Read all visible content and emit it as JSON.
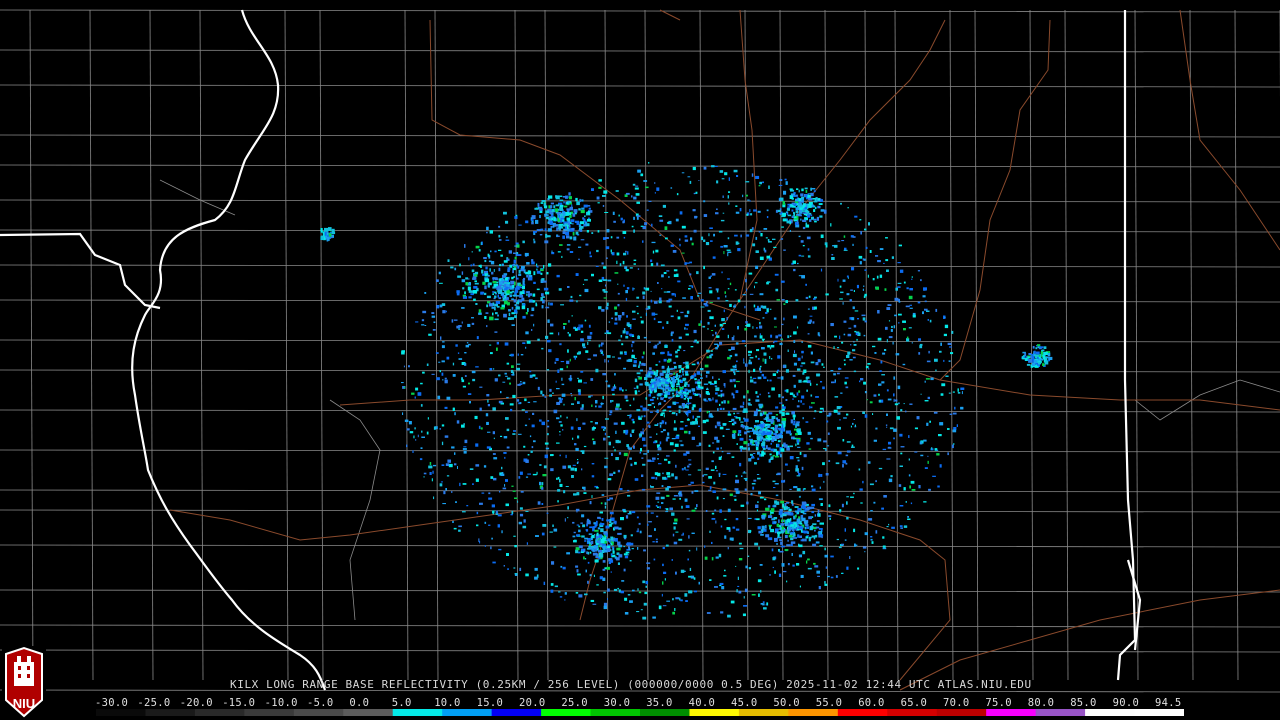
{
  "product": {
    "caption": "KILX LONG RANGE BASE REFLECTIVITY (0.25KM / 256 LEVEL) (000000/0000 0.5 DEG) 2025-11-02 12:44 UTC  ATLAS.NIU.EDU"
  },
  "scale": {
    "labels": [
      "-30.0",
      "-25.0",
      "-20.0",
      "-15.0",
      "-10.0",
      "-5.0",
      "0.0",
      "5.0",
      "10.0",
      "15.0",
      "20.0",
      "25.0",
      "30.0",
      "35.0",
      "40.0",
      "45.0",
      "50.0",
      "55.0",
      "60.0",
      "65.0",
      "70.0",
      "75.0",
      "80.0",
      "85.0",
      "90.0",
      "94.5"
    ],
    "colors": [
      "#0a0a0a",
      "#1a1a1a",
      "#2a2a2a",
      "#3a3a3a",
      "#4a4a4a",
      "#5c5c5c",
      "#04e9e7",
      "#019ff4",
      "#0300f4",
      "#02fd02",
      "#01c501",
      "#008e00",
      "#fdf802",
      "#e5bc00",
      "#fd9500",
      "#fd0000",
      "#d40000",
      "#bc0000",
      "#f800fd",
      "#9854c6",
      "#fdfdfd",
      "#ffffff"
    ]
  },
  "logo": {
    "text": "NIU"
  },
  "map": {
    "radar_colors": [
      "#04e9e7",
      "#1aa0f0",
      "#2a7ae8",
      "#12c2dd",
      "#0b6cf2",
      "#05d24a"
    ]
  }
}
